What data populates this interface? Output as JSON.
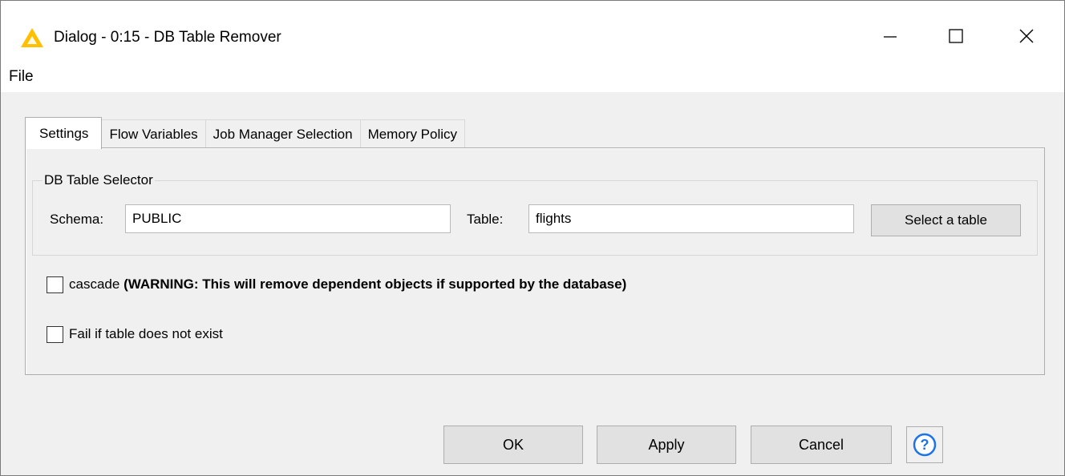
{
  "window": {
    "title": "Dialog - 0:15 - DB Table Remover",
    "icon": "knime-warning-triangle-icon",
    "controls": [
      "minimize-icon",
      "maximize-icon",
      "close-icon"
    ]
  },
  "menu": {
    "file": "File"
  },
  "tabs": [
    {
      "label": "Settings",
      "active": true
    },
    {
      "label": "Flow Variables",
      "active": false
    },
    {
      "label": "Job Manager Selection",
      "active": false
    },
    {
      "label": "Memory Policy",
      "active": false
    }
  ],
  "selector": {
    "group_title": "DB Table Selector",
    "schema_label": "Schema:",
    "schema_value": "PUBLIC",
    "table_label": "Table:",
    "table_value": "flights",
    "select_button": "Select a table"
  },
  "options": {
    "cascade_label": "cascade",
    "cascade_warning": "(WARNING: This will remove dependent objects if supported by the database)",
    "cascade_checked": false,
    "fail_label": "Fail if table does not exist",
    "fail_checked": false
  },
  "buttons": {
    "ok": "OK",
    "apply": "Apply",
    "cancel": "Cancel",
    "help": "?"
  },
  "colors": {
    "icon_yellow": "#ffc000",
    "help_blue": "#1e73e8"
  }
}
